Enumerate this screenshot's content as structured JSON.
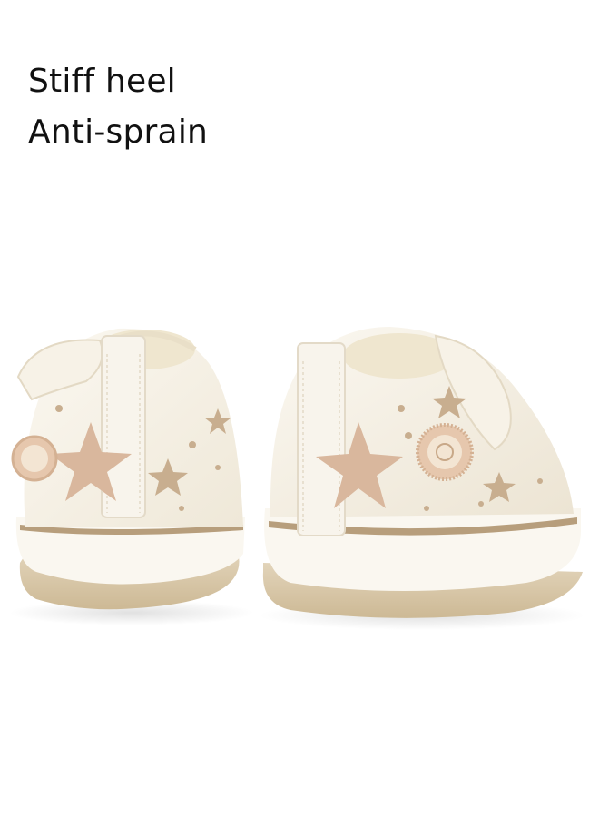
{
  "headline": {
    "line1": "Stiff heel",
    "line2": "Anti-sprain"
  },
  "product_image": {
    "description_icon": "baby-shoes-rear-view",
    "colors": {
      "upper": "#f6f1e6",
      "accent_tan": "#d9b79d",
      "print": "#c8ae8f",
      "sole": "#d8c6a6",
      "stripe": "#b79e7c"
    }
  }
}
